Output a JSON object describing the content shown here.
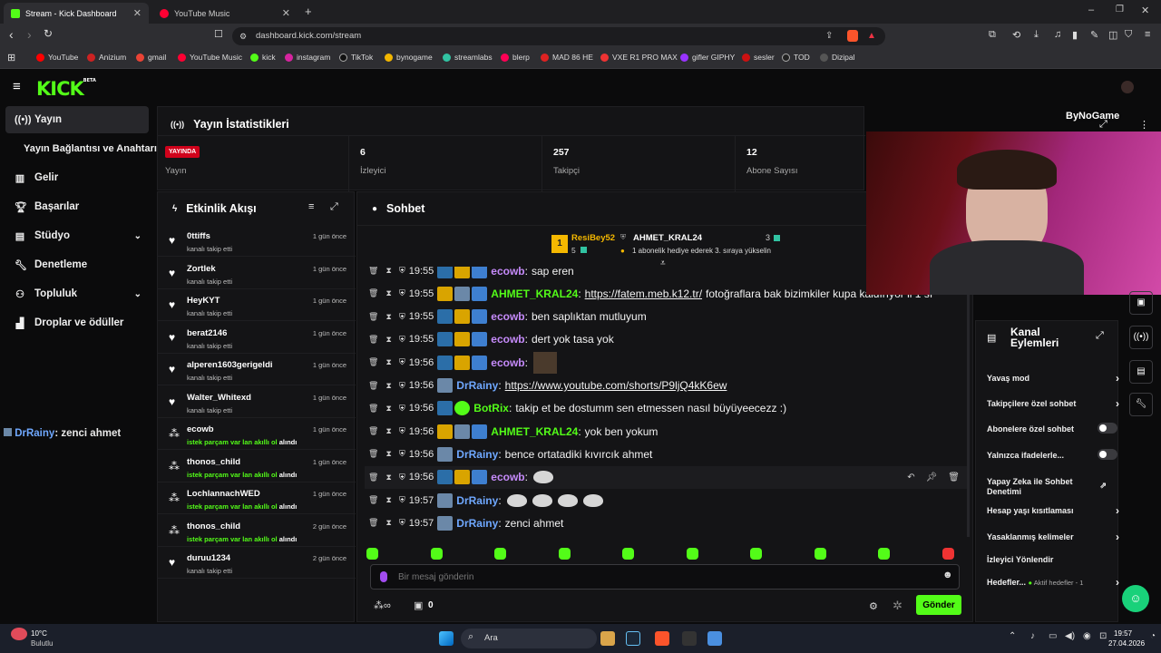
{
  "browser": {
    "tabs": [
      {
        "title": "Stream - Kick Dashboard",
        "active": true
      },
      {
        "title": "YouTube Music",
        "active": false
      }
    ],
    "url": "dashboard.kick.com/stream",
    "bookmarks": [
      "YouTube",
      "Anizium",
      "gmail",
      "YouTube Music",
      "kick",
      "instagram",
      "TikTok",
      "bynogame",
      "streamlabs",
      "blerp",
      "MAD 86 HE",
      "VXE R1 PRO MAX",
      "gifler GIPHY",
      "sesler",
      "TOD",
      "Dizipal"
    ]
  },
  "sidebar": {
    "logo": "KICK",
    "logo_sup": "BETA",
    "items": [
      {
        "label": "Yayın",
        "icon": "broadcast-icon"
      },
      {
        "label": "Yayın Bağlantısı ve Anahtarı",
        "icon": ""
      },
      {
        "label": "Gelir",
        "icon": "chart-icon"
      },
      {
        "label": "Başarılar",
        "icon": "trophy-icon"
      },
      {
        "label": "Stüdyo",
        "icon": "studio-icon"
      },
      {
        "label": "Denetleme",
        "icon": "wrench-icon"
      },
      {
        "label": "Topluluk",
        "icon": "community-icon"
      },
      {
        "label": "Droplar ve ödüller",
        "icon": "drops-icon"
      }
    ],
    "overlay_user": "DrRainy",
    "overlay_text": ": zenci ahmet"
  },
  "stats": {
    "title": "Yayın İstatistikleri",
    "live_badge": "YAYINDA",
    "live_label": "Yayın",
    "viewers": {
      "value": "6",
      "label": "İzleyici"
    },
    "followers": {
      "value": "257",
      "label": "Takipçi"
    },
    "subs": {
      "value": "12",
      "label": "Abone Sayısı"
    }
  },
  "events": {
    "title": "Etkinlik Akışı",
    "items": [
      {
        "name": "0ttiffs",
        "desc": "kanalı takip etti",
        "time": "1 gün önce",
        "type": "follow"
      },
      {
        "name": "Zortlek",
        "desc": "kanalı takip etti",
        "time": "1 gün önce",
        "type": "follow"
      },
      {
        "name": "HeyKYT",
        "desc": "kanalı takip etti",
        "time": "1 gün önce",
        "type": "follow"
      },
      {
        "name": "berat2146",
        "desc": "kanalı takip etti",
        "time": "1 gün önce",
        "type": "follow"
      },
      {
        "name": "alperen1603gerigeldi",
        "desc": "kanalı takip etti",
        "time": "1 gün önce",
        "type": "follow"
      },
      {
        "name": "Walter_Whitexd",
        "desc": "kanalı takip etti",
        "time": "1 gün önce",
        "type": "follow"
      },
      {
        "name": "ecowb",
        "desc": "istek parçam var lan akıllı ol",
        "suffix": "alındı",
        "time": "1 gün önce",
        "type": "reward"
      },
      {
        "name": "thonos_child",
        "desc": "istek parçam var lan akıllı ol",
        "suffix": "alındı",
        "time": "1 gün önce",
        "type": "reward"
      },
      {
        "name": "LochlannachWED",
        "desc": "istek parçam var lan akıllı ol",
        "suffix": "alındı",
        "time": "1 gün önce",
        "type": "reward"
      },
      {
        "name": "thonos_child",
        "desc": "istek parçam var lan akıllı ol",
        "suffix": "alındı",
        "time": "2 gün önce",
        "type": "reward"
      },
      {
        "name": "duruu1234",
        "desc": "kanalı takip etti",
        "time": "2 gün önce",
        "type": "follow"
      }
    ]
  },
  "chat": {
    "title": "Sohbet",
    "leaderboard": {
      "rank": "1",
      "user1": "ResiBey52",
      "user1_count": "5",
      "user2": "AHMET_KRAL24",
      "user2_count": "3",
      "note": "1 abonelik hediye ederek 3. sıraya yükselin"
    },
    "messages": [
      {
        "time": "19:55",
        "user": "ecowb",
        "color": "#c58af9",
        "badges": [
          "gift",
          "crown",
          "sub"
        ],
        "text": "sap eren",
        "link": ""
      },
      {
        "time": "19:55",
        "user": "AHMET_KRAL24",
        "color": "#53fc18",
        "badges": [
          "crown",
          "pfp",
          "sub"
        ],
        "text": "fotoğraflara bak bizimkiler kupa kaldırıyor ii 1 sı",
        "link": "https://fatem.meb.k12.tr/"
      },
      {
        "time": "19:55",
        "user": "ecowb",
        "color": "#c58af9",
        "badges": [
          "gift",
          "crown",
          "sub"
        ],
        "text": "ben saplıktan mutluyum",
        "link": ""
      },
      {
        "time": "19:55",
        "user": "ecowb",
        "color": "#c58af9",
        "badges": [
          "gift",
          "crown",
          "sub"
        ],
        "text": "dert yok tasa yok",
        "link": ""
      },
      {
        "time": "19:56",
        "user": "ecowb",
        "color": "#c58af9",
        "badges": [
          "gift",
          "crown",
          "sub"
        ],
        "text": "",
        "link": "",
        "image": true
      },
      {
        "time": "19:56",
        "user": "DrRainy",
        "color": "#6fa8ff",
        "badges": [
          "pfp"
        ],
        "text": "",
        "link": "https://www.youtube.com/shorts/P9ljQ4kK6ew"
      },
      {
        "time": "19:56",
        "user": "BotRix",
        "color": "#53fc18",
        "badges": [
          "gift",
          "bot"
        ],
        "text": "takip et be dostumm sen etmessen nasıl büyüyeecezz :)",
        "link": ""
      },
      {
        "time": "19:56",
        "user": "AHMET_KRAL24",
        "color": "#53fc18",
        "badges": [
          "crown",
          "pfp",
          "sub"
        ],
        "text": "yok ben yokum",
        "link": ""
      },
      {
        "time": "19:56",
        "user": "DrRainy",
        "color": "#6fa8ff",
        "badges": [
          "pfp"
        ],
        "text": "bence ortatadiki kıvırcık ahmet",
        "link": ""
      },
      {
        "time": "19:56",
        "user": "ecowb",
        "color": "#c58af9",
        "badges": [
          "gift",
          "crown",
          "sub"
        ],
        "text": "",
        "link": "",
        "emotes": 1
      },
      {
        "time": "19:57",
        "user": "DrRainy",
        "color": "#6fa8ff",
        "badges": [
          "pfp"
        ],
        "text": "",
        "link": "",
        "emotes": 4
      },
      {
        "time": "19:57",
        "user": "DrRainy",
        "color": "#6fa8ff",
        "badges": [
          "pfp"
        ],
        "text": "zenci ahmet",
        "link": ""
      }
    ],
    "input_placeholder": "Bir mesaj gönderin",
    "points_value": "0",
    "send_label": "Gönder"
  },
  "actions": {
    "title": "Kanal Eylemleri",
    "items": [
      {
        "label": "Yavaş mod",
        "control": "arrow"
      },
      {
        "label": "Takipçilere özel sohbet",
        "control": "arrow"
      },
      {
        "label": "Abonelere özel sohbet",
        "control": "toggle"
      },
      {
        "label": "Yalnızca ifadelerle...",
        "control": "toggle"
      },
      {
        "label": "Yapay Zeka ile Sohbet Denetimi",
        "control": "external"
      },
      {
        "label": "Hesap yaşı kısıtlaması",
        "control": "arrow"
      },
      {
        "label": "Yasaklanmış kelimeler",
        "control": "arrow"
      },
      {
        "label": "İzleyici Yönlendir",
        "control": "none"
      },
      {
        "label": "Hedefler...",
        "control": "arrow",
        "note": "Aktif hedefler - 1"
      }
    ]
  },
  "webcam_watermark": "ByNoGame",
  "taskbar": {
    "weather_temp": "10°C",
    "weather_desc": "Bulutlu",
    "search_label": "Ara",
    "time": "19:57",
    "date": "27.04.2026"
  },
  "colors": {
    "kick_green": "#53fc18",
    "live_red": "#d0021b",
    "bg": "#0b0b0c",
    "panel": "#141416"
  }
}
